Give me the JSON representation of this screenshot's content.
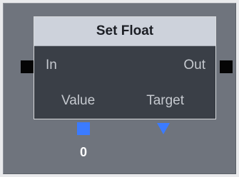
{
  "node": {
    "title": "Set Float",
    "ports": {
      "in": "In",
      "out": "Out",
      "value": "Value",
      "target": "Target"
    },
    "value_display": "0"
  },
  "colors": {
    "canvas": "#6f747d",
    "node_body": "#3a3f47",
    "node_header": "#cdd2db",
    "port_accent": "#3b7bff",
    "exec_connector": "#050505"
  },
  "icons": {
    "in_connector": "square",
    "out_connector": "square",
    "value_port": "square",
    "target_port": "triangle-down"
  }
}
